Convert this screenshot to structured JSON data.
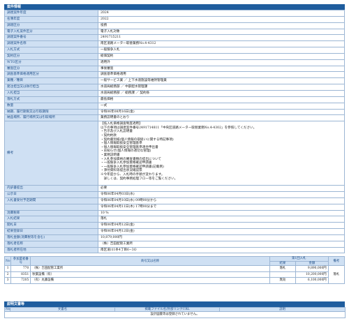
{
  "section1": {
    "title": "案件情報",
    "rows": [
      {
        "label": "調達案件年度",
        "value": "2024"
      },
      {
        "label": "名簿年度",
        "value": "2022"
      },
      {
        "label": "調達区分",
        "value": "役務"
      },
      {
        "label": "電子入札案件区分",
        "value": "電子入札対象"
      },
      {
        "label": "調達案件番号",
        "value": "2491715211"
      },
      {
        "label": "調達案件名称",
        "value": "南区道路メーター取替業務No.4-4312"
      },
      {
        "label": "入札方式",
        "value": "一般競争入札"
      },
      {
        "label": "契約区分",
        "value": "総価契約"
      },
      {
        "label": "WTO区分",
        "value": "適用外"
      },
      {
        "label": "審査区分",
        "value": "事後審査"
      },
      {
        "label": "調査基準価格適用区分",
        "value": "調査基準価格適用"
      },
      {
        "label": "業種／種目",
        "value": "一般サービス業 ／ 上下水道施設等維持管理業"
      },
      {
        "label": "発注担当又は執行担当",
        "value": "水道局総務部 ／ 中部配水管理課"
      },
      {
        "label": "入札担当",
        "value": "水道局総務部 ／ 総務課 ／ 契約係"
      },
      {
        "label": "落札方式",
        "value": "最低価格"
      },
      {
        "label": "数量",
        "value": "一式"
      },
      {
        "label": "納期、履行期限又は引取期限",
        "value": "令和06年08月16日(金)"
      },
      {
        "label": "納品場所、履行場所又は引取場所",
        "value": "業務説明書のとおり"
      }
    ],
    "note": {
      "label": "備考",
      "lines": [
        "【低入札価格調査制度適用】",
        "以下の事項は調達案件番号2491714811「中央区道路メーター取替業務No.4-4302」を参照してください。",
        "・告示及び入札説明書",
        "・契約約款",
        "・契約書別紙(個人情報の取扱いに関する特記事項)",
        "・個人情報取扱安全管理基準",
        "・個人情報取扱安全管理基準適合申出書",
        "・お知らせ(個人情報の適切な管理)",
        "・業務説明書",
        "・入札参加資格の審査書類の提出について",
        "・一般競争入札参加資格確認申請書",
        "・一般競争入札参加資格確認申請書(記載例)",
        "・添付資料等提出状況確認票",
        "※今年度から、入札時の手順が変わります。",
        "　詳しくは、契約事務処理フロー等をご覧ください。"
      ]
    },
    "rows2": [
      {
        "label": "内訳書提出",
        "value": "必要"
      },
      {
        "label": "公示日",
        "value": "令和06年04月03日(水)"
      },
      {
        "label": "入札書受付予定期間",
        "value": "令和06年04月10日(水) 09時00分から"
      },
      {
        "label": "",
        "value": "令和06年04月11日(木) 17時00分まで"
      },
      {
        "label": "消費税率",
        "value": "10 %"
      },
      {
        "label": "入札結果",
        "value": "落札"
      },
      {
        "label": "開札日",
        "value": "令和06年04月12日(金)"
      },
      {
        "label": "結果登録日",
        "value": "令和06年04月12日(金)"
      },
      {
        "label": "落札金額(消費税等を含む)",
        "value": "10,879,000円"
      },
      {
        "label": "落札者名称",
        "value": "（株）吉田配管工業所"
      },
      {
        "label": "落札者所在地",
        "value": "南区道川1条4丁目6−3O"
      }
    ]
  },
  "results": {
    "headers": {
      "no": "No",
      "num": "参加業者番号",
      "name": "商号又は名称",
      "round1": "第1回入札",
      "result": "結果",
      "amount": "金額",
      "remark": "備考"
    },
    "remark_value": "落札",
    "rows": [
      {
        "no": "1",
        "num": "770",
        "name": "（株）吉田配管工業所",
        "result": "落札",
        "amount": "9,890,000円"
      },
      {
        "no": "2",
        "num": "8351",
        "name": "秋葉設備（有）",
        "result": "",
        "amount": "10,200,000円"
      },
      {
        "no": "3",
        "num": "7205",
        "name": "（有）丸藤設備",
        "result": "無効",
        "amount": "6,100,000円"
      }
    ]
  },
  "docs": {
    "title": "説明文書等",
    "headers": {
      "no": "No",
      "doc": "文書名",
      "file": "掲載ファイル名/外部リンクURL",
      "desc": "説明"
    },
    "empty": "設計図書等は登録されていません。"
  }
}
